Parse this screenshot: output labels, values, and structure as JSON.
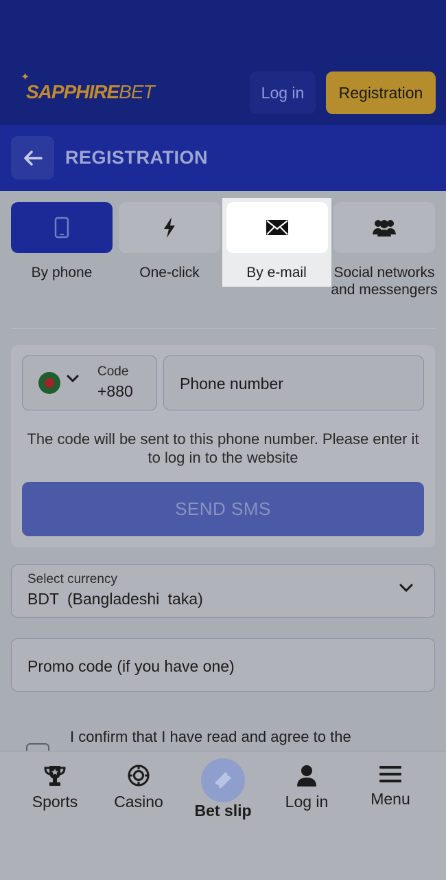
{
  "header": {
    "logo_text_main": "SAPPHIRE",
    "logo_text_accent": "BET",
    "login_label": "Log in",
    "registration_label": "Registration"
  },
  "subheader": {
    "title": "REGISTRATION"
  },
  "tabs": [
    {
      "label": "By phone",
      "icon": "phone-icon"
    },
    {
      "label": "One-click",
      "icon": "lightning-icon"
    },
    {
      "label": "By e-mail",
      "icon": "envelope-icon"
    },
    {
      "label": "Social networks and messengers",
      "icon": "people-icon"
    }
  ],
  "phone_form": {
    "code_label": "Code",
    "code_value": "+880",
    "phone_placeholder": "Phone number",
    "hint": "The code will be sent to this phone number. Please enter it to log in to the website",
    "send_label": "SEND SMS"
  },
  "currency": {
    "label": "Select currency",
    "value": "BDT  (Bangladeshi taka)"
  },
  "promo": {
    "placeholder": "Promo code (if you have one)"
  },
  "confirm_text": "I confirm that I have read and agree to the",
  "nav": {
    "sports": "Sports",
    "casino": "Casino",
    "bet_slip": "Bet slip",
    "login": "Log in",
    "menu": "Menu"
  },
  "colors": {
    "brand_blue": "#1b2a96",
    "gold": "#b58d2c",
    "send_button": "#4a5aa7"
  }
}
